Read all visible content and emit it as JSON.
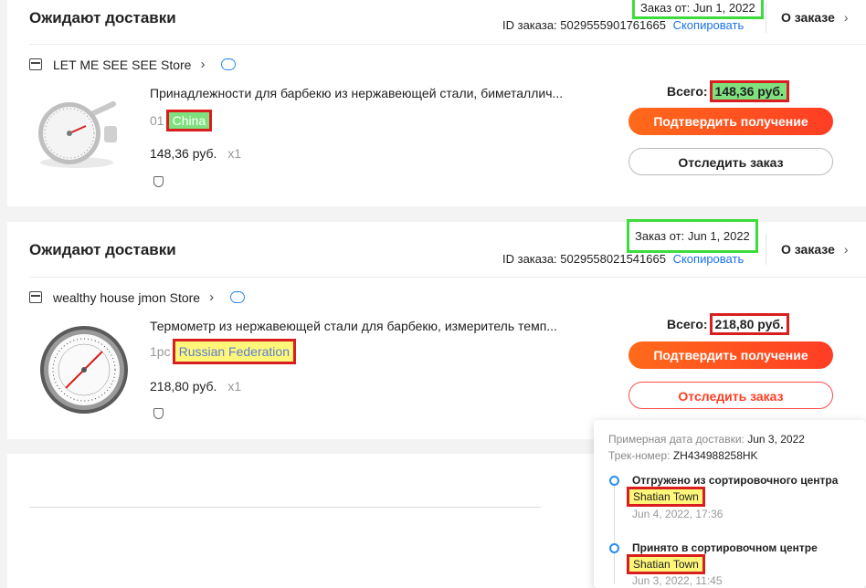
{
  "orders": [
    {
      "status": "Ожидают доставки",
      "date": "Заказ от: Jun 1, 2022",
      "order_id_label": "ID заказа: 5029555901761665",
      "copy_label": "Скопировать",
      "about_label": "О заказе",
      "store": "LET ME SEE SEE Store",
      "product_title": "Принадлежности для барбекю из нержавеющей стали, биметаллич...",
      "spec_prefix": "01",
      "ship_from": "China",
      "price": "148,36 руб.",
      "qty": "x1",
      "total_label": "Всего:",
      "total_value": "148,36 руб.",
      "confirm_label": "Подтвердить получение",
      "track_label": "Отследить заказ"
    },
    {
      "status": "Ожидают доставки",
      "date": "Заказ от: Jun 1, 2022",
      "order_id_label": "ID заказа: 5029558021541665",
      "copy_label": "Скопировать",
      "about_label": "О заказе",
      "store": "wealthy house jmon Store",
      "product_title": "Термометр из нержавеющей стали для барбекю, измеритель темп...",
      "spec_prefix": "1pc",
      "ship_from": "Russian Federation",
      "price": "218,80 руб.",
      "qty": "x1",
      "total_label": "Всего:",
      "total_value": "218,80 руб.",
      "confirm_label": "Подтвердить получение",
      "track_label": "Отследить заказ"
    }
  ],
  "tracking_popup": {
    "eta_label": "Примерная дата доставки:",
    "eta_value": "Jun 3, 2022",
    "tracking_label": "Трек-номер:",
    "tracking_value": "ZH434988258HK",
    "events": [
      {
        "title": "Отгружено из сортировочного центра",
        "place": "Shatian Town",
        "time": "Jun 4, 2022, 17:36"
      },
      {
        "title": "Принято в сортировочном центре",
        "place": "Shatian Town",
        "time": "Jun 3, 2022, 11:45"
      }
    ]
  },
  "colors": {
    "accent_button": "#ff4b1f",
    "link": "#1a73e8",
    "highlight_green": "#7ee07e",
    "highlight_yellow": "#fff67a",
    "highlight_border_red": "#d81e1e",
    "date_border_green": "#3ddc3d"
  },
  "icons": [
    "store-icon",
    "chevron-right-icon",
    "chat-icon",
    "shield-icon"
  ]
}
